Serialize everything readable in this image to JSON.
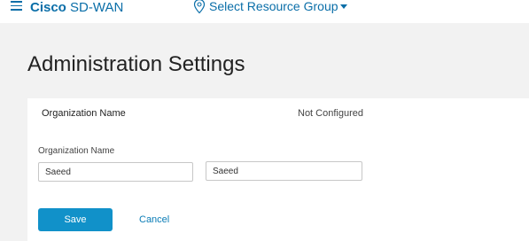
{
  "header": {
    "brand_bold": "Cisco",
    "brand_rest": " SD-WAN",
    "resource_group": "Select Resource Group"
  },
  "page": {
    "title": "Administration Settings"
  },
  "org_section": {
    "label": "Organization Name",
    "status": "Not Configured",
    "field_label": "Organization Name",
    "input_value": "Saeed",
    "confirm_value": "Saeed",
    "save_label": "Save",
    "cancel_label": "Cancel"
  },
  "colors": {
    "accent": "#0a6ea8",
    "primary_button": "#1191c9",
    "background": "#f2f2f2"
  }
}
